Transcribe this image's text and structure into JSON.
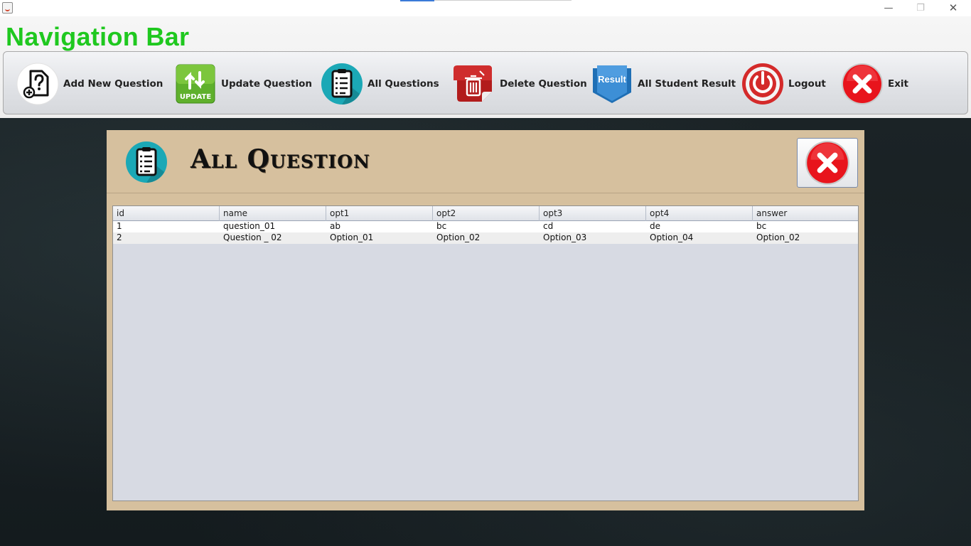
{
  "window": {
    "controls": {
      "minimize": "—",
      "maximize": "❐",
      "close": "✕"
    }
  },
  "header": {
    "title": "Navigation Bar"
  },
  "toolbar": {
    "items": [
      {
        "label": "Add New Question",
        "icon": "add-question-icon"
      },
      {
        "label": "Update Question",
        "icon": "update-icon"
      },
      {
        "label": "All Questions",
        "icon": "document-list-icon"
      },
      {
        "label": "Delete Question",
        "icon": "trash-icon"
      },
      {
        "label": "All Student Result",
        "icon": "result-ribbon-icon"
      },
      {
        "label": "Logout",
        "icon": "power-icon"
      },
      {
        "label": "Exit",
        "icon": "close-circle-icon"
      }
    ],
    "update_icon_text": "UPDATE",
    "result_icon_text": "Result"
  },
  "panel": {
    "title": "All Question",
    "close_icon": "close-circle-icon"
  },
  "table": {
    "columns": [
      "id",
      "name",
      "opt1",
      "opt2",
      "opt3",
      "opt4",
      "answer"
    ],
    "rows": [
      [
        "1",
        "question_01",
        "ab",
        "bc",
        "cd",
        "de",
        "bc"
      ],
      [
        "2",
        "Question _ 02",
        "Option_01",
        "Option_02",
        "Option_03",
        "Option_04",
        "Option_02"
      ]
    ]
  },
  "colors": {
    "nav_title": "#1fc81f",
    "panel_bg": "#d6c09e",
    "table_bg": "#d7dae3",
    "exit_red": "#e8141c"
  }
}
